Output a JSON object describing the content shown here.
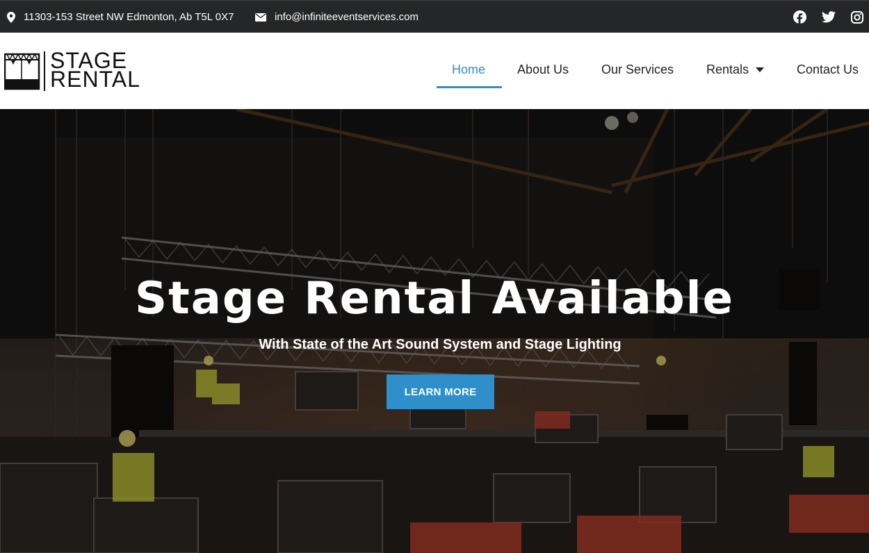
{
  "topbar": {
    "address": "11303-153 Street NW Edmonton, Ab T5L 0X7",
    "email": "info@infiniteeventservices.com",
    "social": [
      "facebook-icon",
      "twitter-icon",
      "instagram-icon"
    ]
  },
  "logo": {
    "line1": "STAGE",
    "line2": "RENTAL"
  },
  "nav": {
    "items": [
      {
        "label": "Home",
        "active": true
      },
      {
        "label": "About Us"
      },
      {
        "label": "Our Services"
      },
      {
        "label": "Rentals",
        "has_dropdown": true
      },
      {
        "label": "Contact Us"
      }
    ]
  },
  "hero": {
    "title": "Stage Rental Available",
    "subtitle": "With State of the Art Sound System and Stage Lighting",
    "button": "LEARN MORE"
  },
  "colors": {
    "accent": "#2e8fcb",
    "topbar": "#252627",
    "text": "#222222"
  }
}
